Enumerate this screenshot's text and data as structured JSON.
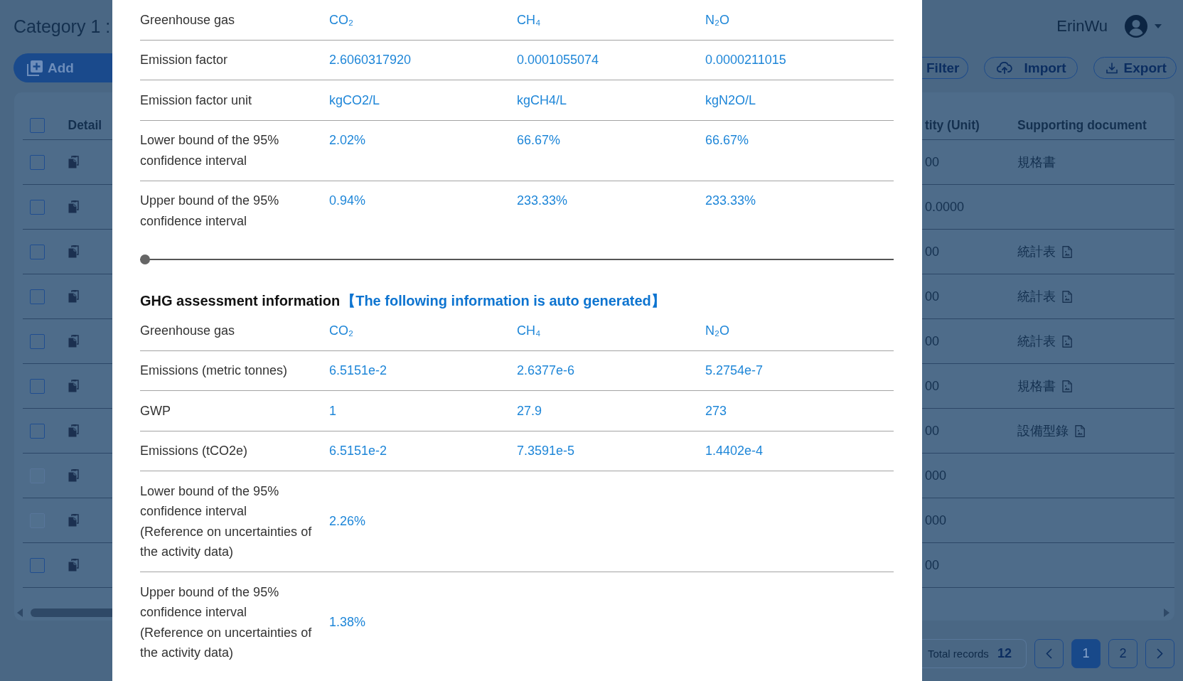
{
  "header": {
    "title": "Category 1 :",
    "user_name": "ErinWu"
  },
  "toolbar": {
    "primary": [
      {
        "label": "Add",
        "kind": "add"
      }
    ],
    "actions": [
      {
        "label": "Filter",
        "kind": "filter"
      },
      {
        "label": "Import",
        "kind": "import"
      },
      {
        "label": "Export",
        "kind": "export"
      }
    ]
  },
  "table": {
    "select_all": {
      "checked": false
    },
    "columns": [
      "Detail",
      "tity (Unit)",
      "Supporting document"
    ],
    "rows": [
      {
        "checked": false,
        "disabled": false,
        "quantity": "00",
        "document": "規格書",
        "file": false
      },
      {
        "checked": false,
        "disabled": false,
        "quantity": "0.0000"
      },
      {
        "checked": false,
        "disabled": false,
        "quantity": "00",
        "document": "統計表",
        "file": true
      },
      {
        "checked": false,
        "disabled": false,
        "quantity": "00",
        "document": "統計表",
        "file": true
      },
      {
        "checked": false,
        "disabled": false,
        "quantity": "00",
        "document": "統計表",
        "file": true
      },
      {
        "checked": false,
        "disabled": false,
        "quantity": "00",
        "document": "規格書",
        "file": true
      },
      {
        "checked": false,
        "disabled": false,
        "quantity": "00",
        "document": "設備型錄",
        "file": true
      },
      {
        "checked": false,
        "disabled": true,
        "quantity": "000"
      },
      {
        "checked": false,
        "disabled": true,
        "quantity": "000"
      },
      {
        "checked": false,
        "disabled": false,
        "quantity": "00"
      }
    ]
  },
  "pagination": {
    "total_label": "Total records",
    "total": "12",
    "pages": [
      {
        "label": "1",
        "selected": true
      },
      {
        "label": "2",
        "selected": false
      }
    ]
  },
  "modal": {
    "factor_table": {
      "rows": [
        {
          "label": "Greenhouse gas",
          "values": [
            "CO₂",
            "CH₄",
            "N₂O"
          ]
        },
        {
          "label": "Emission factor",
          "values": [
            "2.6060317920",
            "0.0001055074",
            "0.0000211015"
          ]
        },
        {
          "label": "Emission factor unit",
          "values": [
            "kgCO2/L",
            "kgCH4/L",
            "kgN2O/L"
          ]
        },
        {
          "label": "Lower bound of the 95% confidence interval",
          "values": [
            "2.02%",
            "66.67%",
            "66.67%"
          ]
        },
        {
          "label": "Upper bound of the 95% confidence interval",
          "values": [
            "0.94%",
            "233.33%",
            "233.33%"
          ]
        }
      ]
    },
    "slider": {
      "level": 0
    },
    "assessment": {
      "title": "GHG assessment information",
      "note": "【The following information is auto generated】",
      "rows": [
        {
          "label": "Greenhouse gas",
          "values": [
            "CO₂",
            "CH₄",
            "N₂O"
          ]
        },
        {
          "label": "Emissions (metric tonnes)",
          "values": [
            "6.5151e-2",
            "2.6377e-6",
            "5.2754e-7"
          ]
        },
        {
          "label": "GWP",
          "values": [
            "1",
            "27.9",
            "273"
          ]
        },
        {
          "label": "Emissions (tCO2e)",
          "values": [
            "6.5151e-2",
            "7.3591e-5",
            "1.4402e-4"
          ]
        },
        {
          "label": "Lower bound of the 95% confidence interval",
          "note": "(Reference on uncertainties of the activity data)",
          "values": [
            "2.26%"
          ]
        },
        {
          "label": "Upper bound of the 95% confidence interval",
          "note": "(Reference on uncertainties of the activity data)",
          "values": [
            "1.38%"
          ]
        }
      ]
    }
  }
}
